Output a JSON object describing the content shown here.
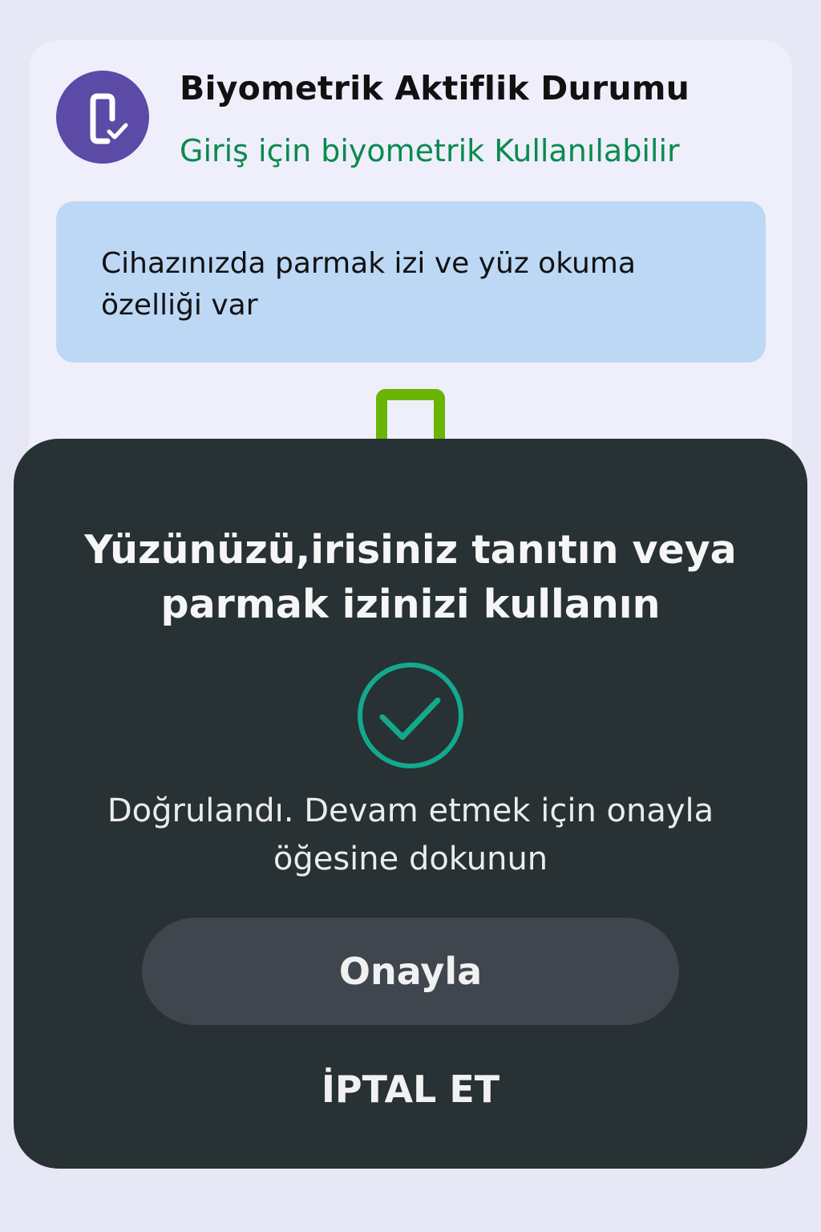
{
  "status_card": {
    "icon": "phone-check-icon",
    "title": "Biyometrik Aktiflik Durumu",
    "subtitle": "Giriş için biyometrik Kullanılabilir",
    "info": "Cihazınızda parmak izi ve yüz okuma özelliği var"
  },
  "dialog": {
    "title": "Yüzünüzü,irisiniz tanıtın veya parmak izinizi kullanın",
    "status_icon": "check-circle-icon",
    "status_text": "Doğrulandı. Devam etmek için onayla öğesine dokunun",
    "confirm_label": "Onayla",
    "cancel_label": "İPTAL ET"
  },
  "colors": {
    "accent_purple": "#5b4aa6",
    "success_green": "#0b8a4e",
    "check_teal": "#12a98d",
    "info_blue": "#bcd8f5",
    "sheet_dark": "#283133",
    "button_dark": "#3f464d",
    "phone_green": "#6ab404"
  }
}
